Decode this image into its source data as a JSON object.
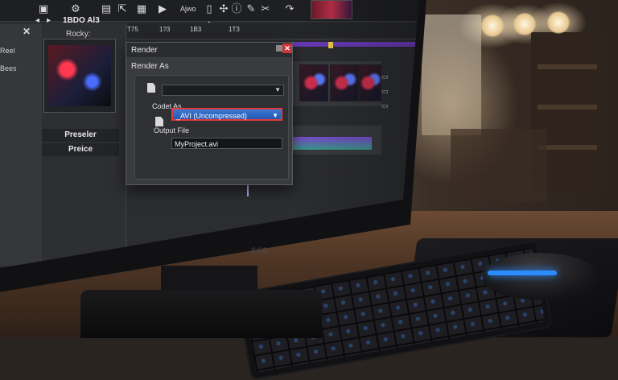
{
  "toolbar": {
    "menu_label": "Ajwo",
    "icons": [
      "save-icon",
      "settings-icon",
      "folder-icon",
      "export-icon",
      "grid-icon",
      "play-icon",
      "undo-icon",
      "redo-icon",
      "cursor-icon",
      "info-icon",
      "chat-icon",
      "cut-icon"
    ]
  },
  "left_panel": {
    "close_glyph": "✕",
    "items": [
      "Reel",
      "Bees"
    ]
  },
  "media_panel": {
    "nav_prev": "◂",
    "nav_next": "▸",
    "title": "1BDO Al3",
    "subtitle": "Rocky:",
    "buttons": [
      "Preseler",
      "Preice"
    ]
  },
  "timeline": {
    "ruler_labels": [
      "T75",
      "1?3",
      "1B3",
      "1T3"
    ]
  },
  "render_dialog": {
    "title": "Render",
    "heading": "Render As",
    "template_value": "",
    "codec_label": "Codet As",
    "format_value": "_AVI (Uncompressed)",
    "output_label": "Output File",
    "output_value": "MyProject.avi",
    "close_glyph": "✕"
  },
  "monitor": {
    "brand": "SSQ"
  },
  "colors": {
    "highlight_border": "#e03a3a",
    "selection_blue": "#2f6cc8",
    "timeline_purple": "#6a3ab8",
    "mouse_glow": "#2a8cff"
  }
}
